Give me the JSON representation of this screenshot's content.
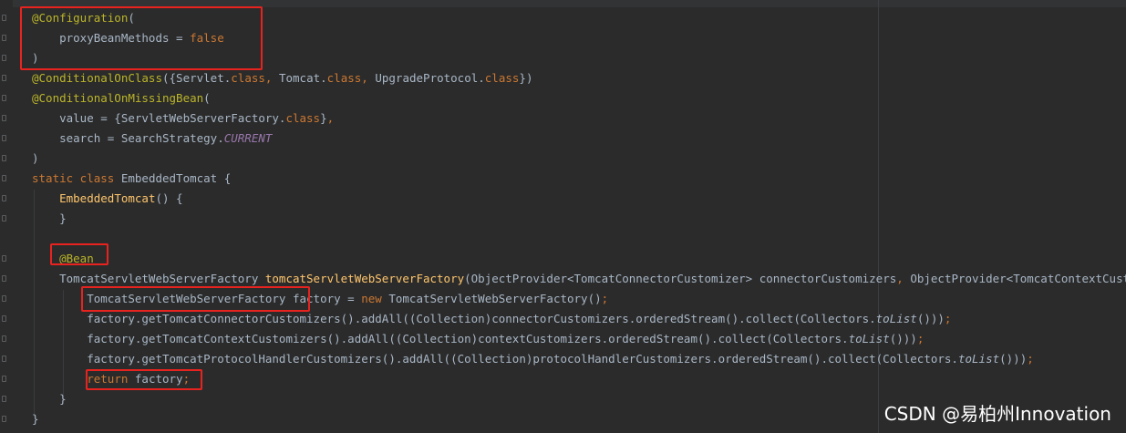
{
  "editor": {
    "theme_colors": {
      "background": "#2b2b2b",
      "annotation": "#bbb529",
      "keyword": "#cc7832",
      "plain": "#a9b7c6",
      "method_declaration": "#ffc66d",
      "static_field": "#9876aa",
      "highlight_box": "#e8231f"
    },
    "lines": [
      {
        "tokens": [
          {
            "t": "@Configuration",
            "c": "ann"
          },
          {
            "t": "(",
            "c": "pl"
          }
        ]
      },
      {
        "tokens": [
          {
            "t": "    proxyBeanMethods = ",
            "c": "pl"
          },
          {
            "t": "false",
            "c": "kw"
          }
        ]
      },
      {
        "tokens": [
          {
            "t": ")",
            "c": "pl"
          }
        ]
      },
      {
        "tokens": [
          {
            "t": "@ConditionalOnClass",
            "c": "ann"
          },
          {
            "t": "({Servlet.",
            "c": "pl"
          },
          {
            "t": "class",
            "c": "kw"
          },
          {
            "t": ", ",
            "c": "kw"
          },
          {
            "t": "Tomcat.",
            "c": "pl"
          },
          {
            "t": "class",
            "c": "kw"
          },
          {
            "t": ", ",
            "c": "kw"
          },
          {
            "t": "UpgradeProtocol.",
            "c": "pl"
          },
          {
            "t": "class",
            "c": "kw"
          },
          {
            "t": "})",
            "c": "pl"
          }
        ]
      },
      {
        "tokens": [
          {
            "t": "@ConditionalOnMissingBean",
            "c": "ann"
          },
          {
            "t": "(",
            "c": "pl"
          }
        ]
      },
      {
        "tokens": [
          {
            "t": "    value = {ServletWebServerFactory.",
            "c": "pl"
          },
          {
            "t": "class",
            "c": "kw"
          },
          {
            "t": "}",
            "c": "pl"
          },
          {
            "t": ",",
            "c": "kw"
          }
        ]
      },
      {
        "tokens": [
          {
            "t": "    search = SearchStrategy.",
            "c": "pl"
          },
          {
            "t": "CURRENT",
            "c": "st"
          }
        ]
      },
      {
        "tokens": [
          {
            "t": ")",
            "c": "pl"
          }
        ]
      },
      {
        "tokens": [
          {
            "t": "static class ",
            "c": "kw"
          },
          {
            "t": "EmbeddedTomcat {",
            "c": "pl"
          }
        ]
      },
      {
        "tokens": [
          {
            "t": "    ",
            "c": "pl"
          },
          {
            "t": "EmbeddedTomcat",
            "c": "fn"
          },
          {
            "t": "() {",
            "c": "pl"
          }
        ]
      },
      {
        "tokens": [
          {
            "t": "    }",
            "c": "pl"
          }
        ]
      },
      {
        "tokens": []
      },
      {
        "tokens": [
          {
            "t": "    ",
            "c": "pl"
          },
          {
            "t": "@Bean",
            "c": "ann"
          }
        ]
      },
      {
        "tokens": [
          {
            "t": "    TomcatServletWebServerFactory ",
            "c": "pl"
          },
          {
            "t": "tomcatServletWebServerFactory",
            "c": "fn"
          },
          {
            "t": "(ObjectProvider<TomcatConnectorCustomizer> connectorCustomizers",
            "c": "pl"
          },
          {
            "t": ", ",
            "c": "kw"
          },
          {
            "t": "ObjectProvider<TomcatContextCustomizer> contextCustomizers",
            "c": "pl"
          }
        ]
      },
      {
        "tokens": [
          {
            "t": "        TomcatServletWebServerFactory factory = ",
            "c": "pl"
          },
          {
            "t": "new ",
            "c": "kw"
          },
          {
            "t": "TomcatServletWebServerFactory()",
            "c": "pl"
          },
          {
            "t": ";",
            "c": "kw"
          }
        ]
      },
      {
        "tokens": [
          {
            "t": "        factory.getTomcatConnectorCustomizers().addAll((Collection)connectorCustomizers.orderedStream().collect(Collectors.",
            "c": "pl"
          },
          {
            "t": "toList",
            "c": "it"
          },
          {
            "t": "()))",
            "c": "pl"
          },
          {
            "t": ";",
            "c": "kw"
          }
        ]
      },
      {
        "tokens": [
          {
            "t": "        factory.getTomcatContextCustomizers().addAll((Collection)contextCustomizers.orderedStream().collect(Collectors.",
            "c": "pl"
          },
          {
            "t": "toList",
            "c": "it"
          },
          {
            "t": "()))",
            "c": "pl"
          },
          {
            "t": ";",
            "c": "kw"
          }
        ]
      },
      {
        "tokens": [
          {
            "t": "        factory.getTomcatProtocolHandlerCustomizers().addAll((Collection)protocolHandlerCustomizers.orderedStream().collect(Collectors.",
            "c": "pl"
          },
          {
            "t": "toList",
            "c": "it"
          },
          {
            "t": "()))",
            "c": "pl"
          },
          {
            "t": ";",
            "c": "kw"
          }
        ]
      },
      {
        "tokens": [
          {
            "t": "        ",
            "c": "pl"
          },
          {
            "t": "return ",
            "c": "kw"
          },
          {
            "t": "factory",
            "c": "pl"
          },
          {
            "t": ";",
            "c": "kw"
          }
        ]
      },
      {
        "tokens": [
          {
            "t": "    }",
            "c": "pl"
          }
        ]
      },
      {
        "tokens": [
          {
            "t": "}",
            "c": "pl"
          }
        ]
      }
    ]
  },
  "watermark": {
    "text": "CSDN @易柏州Innovation"
  }
}
